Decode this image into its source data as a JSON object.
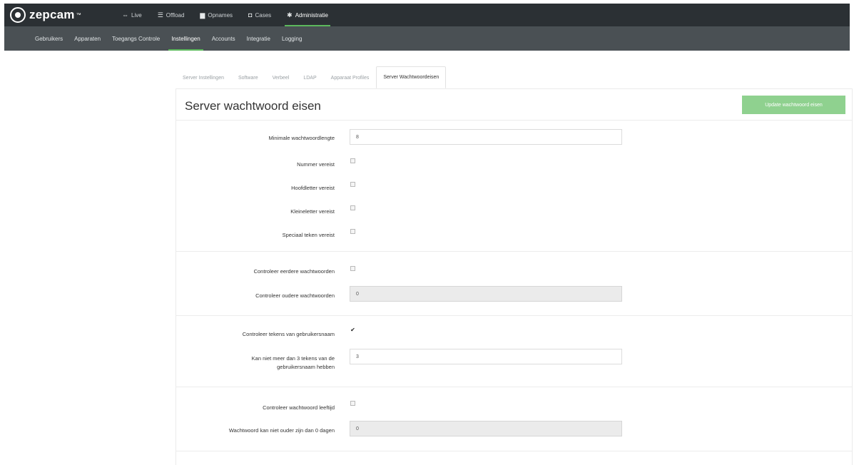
{
  "app": {
    "logo_text": "zepcam",
    "logo_tm": "™"
  },
  "topnav": [
    {
      "icon": "live-icon",
      "glyph": "⇔",
      "label": "Live",
      "active": false
    },
    {
      "icon": "offload-icon",
      "glyph": "☰",
      "label": "Offload",
      "active": false
    },
    {
      "icon": "folder-icon",
      "glyph": "▆",
      "label": "Opnames",
      "active": false
    },
    {
      "icon": "cases-icon",
      "glyph": "◘",
      "label": "Cases",
      "active": false
    },
    {
      "icon": "gear-icon",
      "glyph": "✱",
      "label": "Administratie",
      "active": true
    }
  ],
  "subnav": [
    {
      "label": "Gebruikers",
      "active": false
    },
    {
      "label": "Apparaten",
      "active": false
    },
    {
      "label": "Toegangs Controle",
      "active": false
    },
    {
      "label": "Instellingen",
      "active": true
    },
    {
      "label": "Accounts",
      "active": false
    },
    {
      "label": "Integratie",
      "active": false
    },
    {
      "label": "Logging",
      "active": false
    }
  ],
  "tabs": [
    {
      "label": "Server Instellingen",
      "active": false
    },
    {
      "label": "Software",
      "active": false
    },
    {
      "label": "Verbeel",
      "active": false
    },
    {
      "label": "LDAP",
      "active": false
    },
    {
      "label": "Apparaat Profiles",
      "active": false
    },
    {
      "label": "Server Wachtwoordeisen",
      "active": true
    }
  ],
  "page": {
    "title": "Server wachtwoord eisen",
    "update_button": "Update wachtwoord eisen"
  },
  "form": {
    "min_length": {
      "label": "Minimale wachtwoordlengte",
      "value": "8"
    },
    "number_required": {
      "label": "Nummer vereist",
      "checked": false
    },
    "uppercase_required": {
      "label": "Hoofdletter vereist",
      "checked": false
    },
    "lowercase_required": {
      "label": "Kleineletter vereist",
      "checked": false
    },
    "special_required": {
      "label": "Speciaal teken vereist",
      "checked": false
    },
    "check_previous": {
      "label": "Controleer eerdere wachtwoorden",
      "checked": false
    },
    "check_older": {
      "label": "Controleer oudere wachtwoorden",
      "value": "0"
    },
    "check_username": {
      "label": "Controleer tekens van gebruikersnaam",
      "checked": true,
      "mark": "✔"
    },
    "max_username_chars": {
      "label_line1": "Kan niet meer dan 3 tekens van de",
      "label_line2": "gebruikersnaam hebben",
      "value": "3"
    },
    "check_age": {
      "label": "Controleer wachtwoord leeftijd",
      "checked": false
    },
    "max_age": {
      "label": "Wachtwoord kan niet ouder zijn dan 0 dagen",
      "value": "0"
    }
  },
  "colors": {
    "topbar": "#2b3034",
    "subbar": "#4a5054",
    "accent": "#5cb85c",
    "button": "#8fd18f"
  }
}
